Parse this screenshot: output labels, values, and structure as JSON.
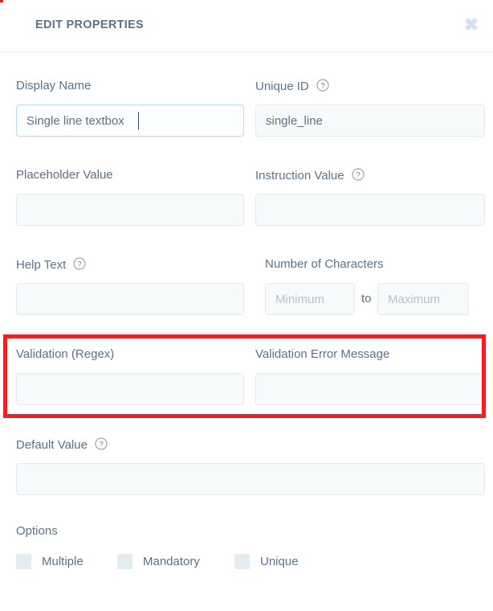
{
  "header": {
    "title": "EDIT PROPERTIES",
    "close_icon": "close-icon",
    "close_glyph": "✖"
  },
  "colors": {
    "label_text": "#5b7189",
    "input_bg": "#f6fafb",
    "input_border": "#e4eaec",
    "focus_border": "#b9dcef",
    "placeholder": "#b4c2cb",
    "annotation_red": "#ed2024",
    "checkbox_fill": "#e3ecf0",
    "close_icon": "#d3e2ea"
  },
  "form": {
    "display_name": {
      "label": "Display Name",
      "value": "Single line textbox",
      "placeholder": "",
      "focused": true,
      "has_help": false
    },
    "unique_id": {
      "label": "Unique ID",
      "value": "single_line",
      "placeholder": "",
      "focused": false,
      "has_help": true,
      "help_icon": "question-circle-icon"
    },
    "placeholder_value": {
      "label": "Placeholder Value",
      "value": "",
      "placeholder": "",
      "focused": false,
      "has_help": false
    },
    "instruction_value": {
      "label": "Instruction Value",
      "value": "",
      "placeholder": "",
      "focused": false,
      "has_help": true,
      "help_icon": "question-circle-icon"
    },
    "help_text": {
      "label": "Help Text",
      "value": "",
      "placeholder": "",
      "focused": false,
      "has_help": true,
      "help_icon": "question-circle-icon"
    },
    "number_of_characters": {
      "label": "Number of Characters",
      "separator": "to",
      "minimum": {
        "value": "",
        "placeholder": "Minimum"
      },
      "maximum": {
        "value": "",
        "placeholder": "Maximum"
      }
    },
    "validation_regex": {
      "label": "Validation (Regex)",
      "value": "",
      "placeholder": "",
      "focused": false,
      "has_help": false
    },
    "validation_error_message": {
      "label": "Validation Error Message",
      "value": "",
      "placeholder": "",
      "focused": false,
      "has_help": false
    },
    "default_value": {
      "label": "Default Value",
      "value": "",
      "placeholder": "",
      "focused": false,
      "has_help": true,
      "help_icon": "question-circle-icon"
    }
  },
  "options": {
    "label": "Options",
    "items": [
      {
        "label": "Multiple",
        "checked": false
      },
      {
        "label": "Mandatory",
        "checked": false
      },
      {
        "label": "Unique",
        "checked": false
      }
    ]
  },
  "annotation": {
    "shape": "rectangle-highlight",
    "color": "#ed2024",
    "targets": [
      "Validation (Regex)",
      "Validation Error Message"
    ]
  }
}
